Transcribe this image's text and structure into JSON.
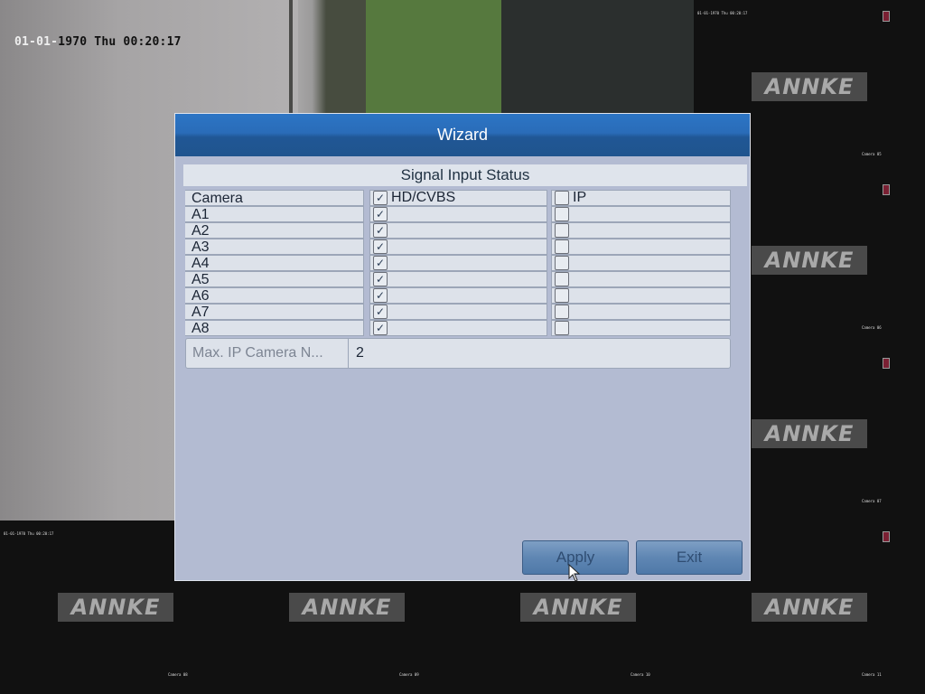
{
  "live_camera": {
    "timestamp_date": "01-01-",
    "timestamp_rest": "1970 Thu 00:20:17"
  },
  "channel_tiles": {
    "logo_text": "ANNKE",
    "osd_timestamp": "01-01-1970 Thu 00:20:17",
    "cells": [
      {
        "name": "Camera 05"
      },
      {
        "name": "Camera 06"
      },
      {
        "name": "Camera 07"
      },
      {
        "name": "Camera 08"
      },
      {
        "name": "Camera 09"
      },
      {
        "name": "Camera 10"
      },
      {
        "name": "Camera 11"
      }
    ]
  },
  "dialog": {
    "title": "Wizard",
    "section_title": "Signal Input Status",
    "columns": {
      "camera": "Camera",
      "hd_cvbs": "HD/CVBS",
      "ip": "IP",
      "hd_cvbs_all_checked": true,
      "ip_all_checked": false
    },
    "rows": [
      {
        "camera": "A1",
        "hd_cvbs": true,
        "ip": false
      },
      {
        "camera": "A2",
        "hd_cvbs": true,
        "ip": false
      },
      {
        "camera": "A3",
        "hd_cvbs": true,
        "ip": false
      },
      {
        "camera": "A4",
        "hd_cvbs": true,
        "ip": false
      },
      {
        "camera": "A5",
        "hd_cvbs": true,
        "ip": false
      },
      {
        "camera": "A6",
        "hd_cvbs": true,
        "ip": false
      },
      {
        "camera": "A7",
        "hd_cvbs": true,
        "ip": false
      },
      {
        "camera": "A8",
        "hd_cvbs": true,
        "ip": false
      }
    ],
    "max_ip_label": "Max. IP Camera N...",
    "max_ip_value": "2",
    "apply_label": "Apply",
    "exit_label": "Exit",
    "check_glyph": "✓"
  }
}
